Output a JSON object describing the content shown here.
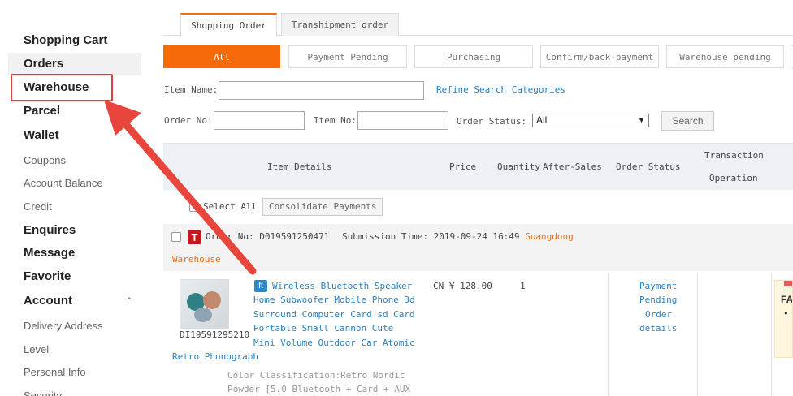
{
  "sidebar": {
    "shopping_cart": "Shopping Cart",
    "orders": "Orders",
    "warehouse": "Warehouse",
    "parcel": "Parcel",
    "wallet": "Wallet",
    "coupons": "Coupons",
    "account_balance": "Account Balance",
    "credit": "Credit",
    "enquires": "Enquires",
    "message": "Message",
    "favorite": "Favorite",
    "account": "Account",
    "delivery_address": "Delivery Address",
    "level": "Level",
    "personal_info": "Personal Info",
    "security": "Security"
  },
  "tabs": {
    "shopping_order": "Shopping Order",
    "transhipment_order": "Transhipment order"
  },
  "status_filters": {
    "all": "All",
    "payment_pending": "Payment Pending",
    "purchasing": "Purchasing",
    "confirm_back_payment": "Confirm/back-payment",
    "warehouse_pending": "Warehouse pending"
  },
  "search": {
    "item_name_label": "Item Name:",
    "refine_link": "Refine Search Categories",
    "order_no_label": "Order No:",
    "item_no_label": "Item No:",
    "order_status_label": "Order Status:",
    "order_status_value": "All",
    "search_button": "Search"
  },
  "table_header": {
    "item_details": "Item Details",
    "price": "Price",
    "quantity": "Quantity",
    "after_sales": "After-Sales",
    "order_status": "Order Status",
    "transaction": "Transaction",
    "operation": "Operation"
  },
  "bulk": {
    "select_all": "Select All",
    "consolidate": "Consolidate Payments"
  },
  "order": {
    "store_badge": "T",
    "order_no_label": "Order No:",
    "order_no": "D019591250471",
    "submission_label": "Submission Time:",
    "submission_time": "2019-09-24 16:49",
    "warehouse_region": "Guangdong",
    "warehouse_word": "Warehouse",
    "item_id": "DI19591295210",
    "source_badge": "ft",
    "title_lines": [
      "Wireless Bluetooth Speaker",
      "Home Subwoofer Mobile Phone 3d",
      "Surround Computer Card sd Card",
      "Portable Small Cannon Cute",
      "Mini Volume Outdoor Car Atomic",
      "Retro Phonograph"
    ],
    "price": "CN ¥ 128.00",
    "quantity": "1",
    "status_lines": [
      "Payment",
      "Pending",
      "Order",
      "details"
    ],
    "color_lines": [
      "Color Classification:Retro Nordic",
      "Powder [5.0 Bluetooth + Card + AUX"
    ],
    "side_note_text": "FA",
    "side_note_bullet": "•"
  },
  "colors": {
    "accent_orange": "#f66a0a",
    "link_blue": "#2a7fbf",
    "highlight_red": "#d9423a"
  }
}
